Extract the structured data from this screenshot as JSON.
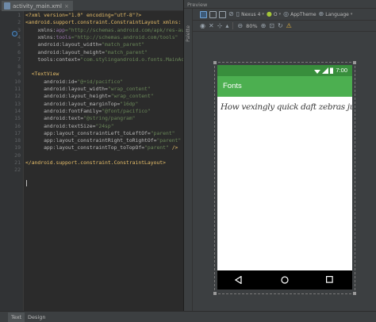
{
  "editor": {
    "file_tab": "activity_main.xml",
    "file_close": "×",
    "line_numbers": [
      "1",
      "2",
      "3",
      "4",
      "5",
      "6",
      "7",
      "8",
      "9",
      "10",
      "11",
      "12",
      "13",
      "14",
      "15",
      "16",
      "17",
      "18",
      "19",
      "20",
      "21",
      "22"
    ],
    "code": {
      "l1": "<?xml version=\"1.0\" encoding=\"utf-8\"?>",
      "l2": "<android.support.constraint.ConstraintLayout xmlns:",
      "l3a": "    xmlns:",
      "l3b": "app",
      "l3c": "=\"http://schemas.android.com/apk/res-auto\"",
      "l4a": "    xmlns:",
      "l4b": "tools",
      "l4c": "=\"http://schemas.android.com/tools\"",
      "l5a": "    android:layout_width=",
      "l5b": "\"match_parent\"",
      "l6a": "    android:layout_height=",
      "l6b": "\"match_parent\"",
      "l7a": "    tools:context=",
      "l7b": "\"com.stylingandroid.o.fonts.MainActi",
      "l9": "  <TextView",
      "l10a": "      android:id=",
      "l10b": "\"@+id/pacifico\"",
      "l11a": "      android:layout_width=",
      "l11b": "\"wrap_content\"",
      "l12a": "      android:layout_height=",
      "l12b": "\"wrap_content\"",
      "l13a": "      android:layout_marginTop=",
      "l13b": "\"16dp\"",
      "l14a": "      android:fontFamily=",
      "l14b": "\"@font/pacifico\"",
      "l15a": "      android:text=",
      "l15b": "\"@string/pangram\"",
      "l16a": "      android:textSize=",
      "l16b": "\"24sp\"",
      "l17a": "      app:layout_constraintLeft_toLeftOf=",
      "l17b": "\"parent\"",
      "l18a": "      app:layout_constraintRight_toRightOf=",
      "l18b": "\"parent\"",
      "l19a": "      app:layout_constraintTop_toTopOf=",
      "l19b": "\"parent\"",
      "l19c": " />",
      "l21": "</android.support.constraint.ConstraintLayout>"
    }
  },
  "preview": {
    "title": "Preview",
    "palette_label": "Palette",
    "device": "Nexus 4",
    "api_level": "O",
    "theme": "AppTheme",
    "language": "Language",
    "zoom": "80%",
    "app_title": "Fonts",
    "status_time": "7:00",
    "pangram": "How vexingly quick daft zebras jump"
  },
  "bottom_tabs": {
    "text": "Text",
    "design": "Design"
  },
  "colors": {
    "status_bar": "#388e3c",
    "app_bar": "#4caf50",
    "editor_bg": "#2b2b2b"
  }
}
